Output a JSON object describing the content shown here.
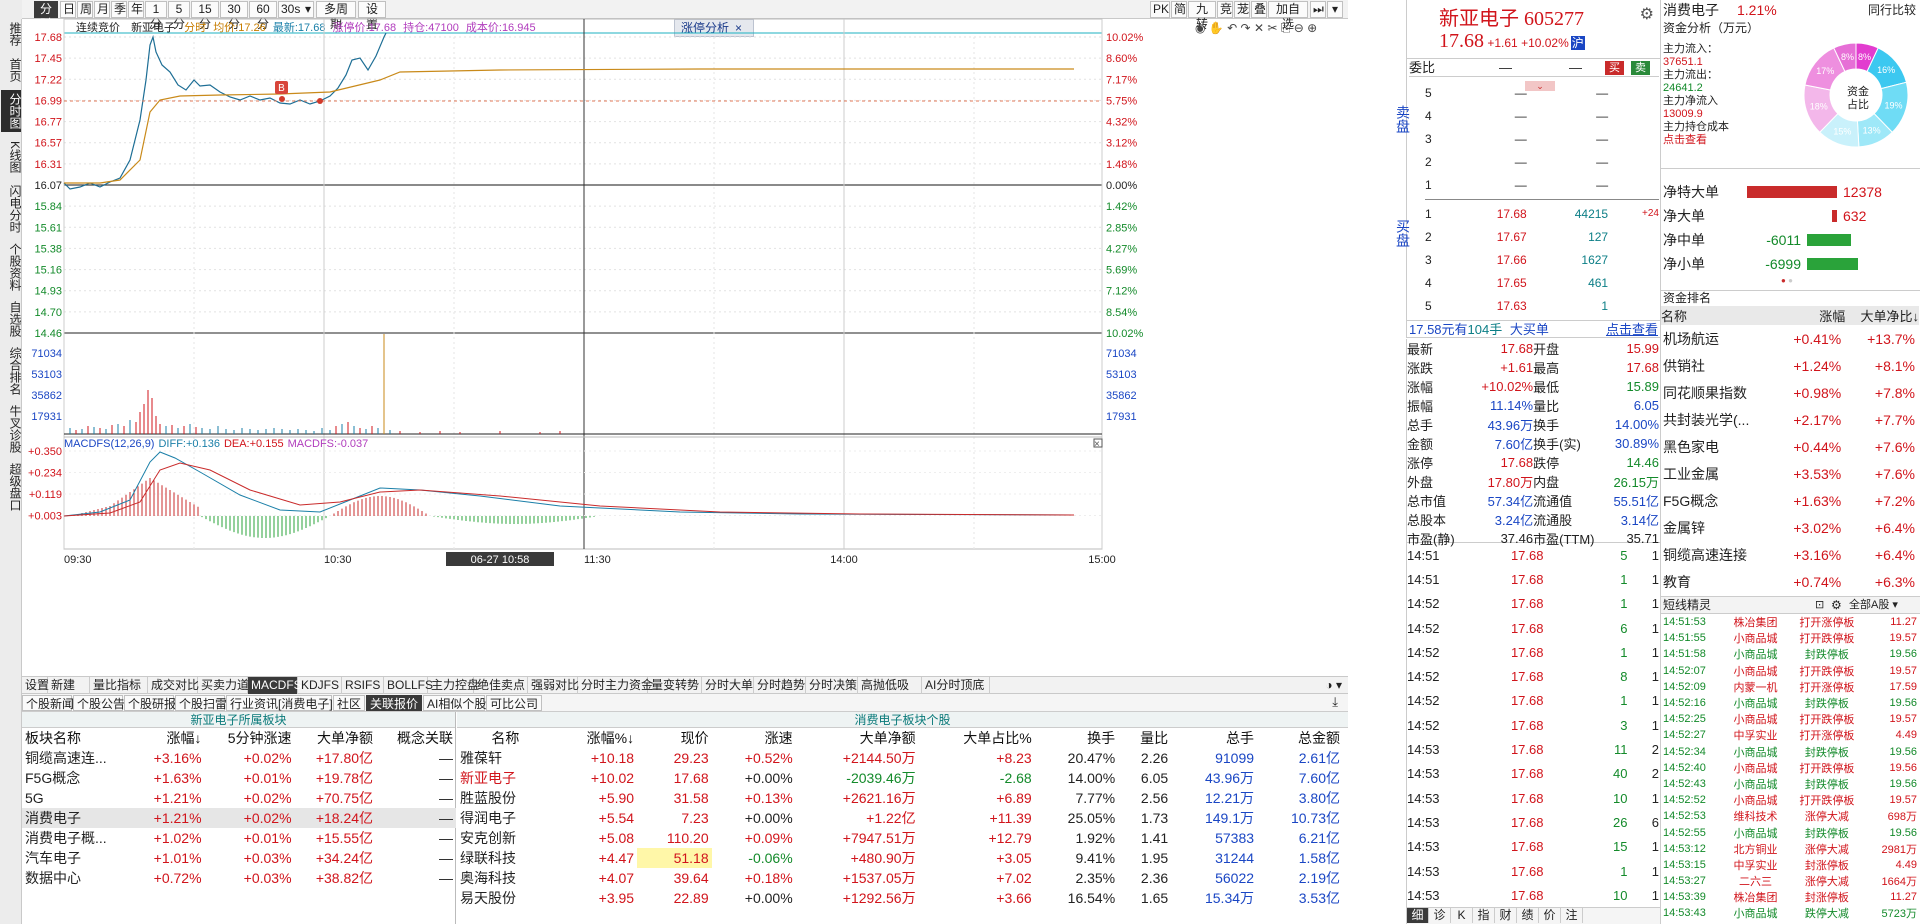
{
  "left_nav": [
    "推荐",
    "首页",
    "分时图",
    "K线图",
    "闪电分时",
    "个股资料",
    "自选股",
    "综合排名",
    "牛叉诊股",
    "超级盘口"
  ],
  "toolbar": {
    "items": [
      "分时",
      "日",
      "周",
      "月",
      "季",
      "年",
      "1分",
      "5分",
      "15分",
      "30分",
      "60分",
      "30s",
      "多周期",
      "设置"
    ],
    "right_items": [
      "PK",
      "简",
      "九转",
      "竞",
      "茏",
      "叠",
      "加自选"
    ],
    "period_select": "30s"
  },
  "chart_info": {
    "label": "连续竞价",
    "name": "新亚电子",
    "ind1": "分时",
    "avg_label": "均价:",
    "avg": "17.26",
    "latest_label": "最新:",
    "latest": "17.68",
    "limit_label": "涨停价:",
    "limit": "17.68",
    "hold_label": "持仓:",
    "hold": "47100",
    "cost_label": "成本价:",
    "cost": "16.945",
    "analysis_btn": "涨停分析"
  },
  "price_axis": {
    "left": [
      "17.68",
      "17.45",
      "17.22",
      "16.99",
      "16.77",
      "16.57",
      "16.31",
      "16.07",
      "15.84",
      "15.61",
      "15.38",
      "15.16",
      "14.93",
      "14.70",
      "14.46"
    ],
    "right": [
      "10.02%",
      "8.60%",
      "7.17%",
      "5.75%",
      "4.32%",
      "3.12%",
      "1.48%",
      "0.00%",
      "1.42%",
      "2.85%",
      "4.27%",
      "5.69%",
      "7.12%",
      "8.54%",
      "10.02%"
    ]
  },
  "vol_axis": {
    "left": [
      "71034",
      "53103",
      "35862",
      "17931"
    ],
    "right": [
      "71034",
      "53103",
      "35862",
      "17931"
    ]
  },
  "macd": {
    "title": "MACDFS(12,26,9)",
    "diff_label": "DIFF:",
    "diff": "+0.136",
    "dea_label": "DEA:",
    "dea": "+0.155",
    "macd_label": "MACDFS:",
    "macd": "-0.037",
    "axis": [
      "+0.350",
      "+0.234",
      "+0.119",
      "+0.003"
    ]
  },
  "time_axis": [
    "09:30",
    "10:30",
    "06-27 10:58",
    "11:30",
    "14:00",
    "15:00"
  ],
  "chart_data": {
    "type": "line",
    "title": "",
    "x": [
      "09:30",
      "10:30",
      "11:30",
      "14:00",
      "15:00"
    ],
    "price_range": [
      14.46,
      17.68
    ],
    "prev_close": 16.07,
    "ylabel": "",
    "note_marker": "B"
  },
  "indicator_tabs": [
    "设置",
    "新建",
    "量比指标",
    "成交对比",
    "买卖力道",
    "MACDFS",
    "KDJFS",
    "RSIFS",
    "BOLLFS",
    "主力控盘",
    "绝佳卖点",
    "强弱对比",
    "分时主力资金",
    "量变转势",
    "分时大单",
    "分时趋势",
    "分时决策",
    "高抛低吸",
    "AI分时顶底"
  ],
  "news_tabs": [
    "个股新闻",
    "个股公告",
    "个股研报",
    "个股扫雷",
    "行业资讯[消费电子]",
    "社区",
    "关联报价",
    "AI相似个股",
    "可比公司"
  ],
  "sector_section": {
    "title": "新亚电子所属板块",
    "headers": [
      "板块名称",
      "涨幅↓",
      "5分钟涨速",
      "大单净额",
      "概念关联"
    ],
    "rows": [
      [
        "铜缆高速连...",
        "+3.16%",
        "+0.02%",
        "+17.80亿",
        "—"
      ],
      [
        "F5G概念",
        "+1.63%",
        "+0.01%",
        "+19.78亿",
        "—"
      ],
      [
        "5G",
        "+1.21%",
        "+0.02%",
        "+70.75亿",
        "—"
      ],
      [
        "消费电子",
        "+1.21%",
        "+0.02%",
        "+18.24亿",
        "—"
      ],
      [
        "消费电子概...",
        "+1.02%",
        "+0.01%",
        "+15.55亿",
        "—"
      ],
      [
        "汽车电子",
        "+1.01%",
        "+0.03%",
        "+34.24亿",
        "—"
      ],
      [
        "数据中心",
        "+0.72%",
        "+0.03%",
        "+38.82亿",
        "—"
      ]
    ]
  },
  "stock_section": {
    "title": "消费电子板块个股",
    "headers": [
      "名称",
      "涨幅%↓",
      "现价",
      "涨速",
      "大单净额",
      "大单占比%",
      "换手",
      "量比",
      "总手",
      "总金额"
    ],
    "rows": [
      [
        "雅葆轩",
        "+10.18",
        "29.23",
        "+0.52%",
        "+2144.50万",
        "+8.23",
        "20.47%",
        "2.26",
        "91099",
        "2.61亿"
      ],
      [
        "新亚电子",
        "+10.02",
        "17.68",
        "+0.00%",
        "-2039.46万",
        "-2.68",
        "14.00%",
        "6.05",
        "43.96万",
        "7.60亿"
      ],
      [
        "胜蓝股份",
        "+5.90",
        "31.58",
        "+0.13%",
        "+2621.16万",
        "+6.89",
        "7.77%",
        "2.56",
        "12.21万",
        "3.80亿"
      ],
      [
        "得润电子",
        "+5.54",
        "7.23",
        "+0.00%",
        "+1.22亿",
        "+11.39",
        "25.05%",
        "1.73",
        "149.1万",
        "10.73亿"
      ],
      [
        "安克创新",
        "+5.08",
        "110.20",
        "+0.09%",
        "+7947.51万",
        "+12.79",
        "1.92%",
        "1.41",
        "57383",
        "6.21亿"
      ],
      [
        "绿联科技",
        "+4.47",
        "51.18",
        "-0.06%",
        "+480.90万",
        "+3.05",
        "9.41%",
        "1.95",
        "31244",
        "1.58亿"
      ],
      [
        "奥海科技",
        "+4.07",
        "39.64",
        "+0.18%",
        "+1537.05万",
        "+7.02",
        "2.35%",
        "2.36",
        "56022",
        "2.19亿"
      ],
      [
        "易天股份",
        "+3.95",
        "22.89",
        "+0.00%",
        "+1292.56万",
        "+3.66",
        "16.54%",
        "1.65",
        "15.34万",
        "3.53亿"
      ]
    ]
  },
  "quote": {
    "name": "新亚电子",
    "code": "605277",
    "price": "17.68",
    "change": "+1.61",
    "pct": "+10.02%",
    "exch": "沪",
    "weibi_label": "委比",
    "weibi": "—",
    "weicha": "—",
    "buy": "买",
    "sell": "卖",
    "asks": [
      [
        "5",
        "—",
        "—"
      ],
      [
        "4",
        "—",
        "—"
      ],
      [
        "3",
        "—",
        "—"
      ],
      [
        "2",
        "—",
        "—"
      ],
      [
        "1",
        "—",
        "—"
      ]
    ],
    "bids": [
      [
        "1",
        "17.68",
        "44215",
        "+24"
      ],
      [
        "2",
        "17.67",
        "127",
        ""
      ],
      [
        "3",
        "17.66",
        "1627",
        ""
      ],
      [
        "4",
        "17.65",
        "461",
        ""
      ],
      [
        "5",
        "17.63",
        "1",
        ""
      ]
    ],
    "ask_side_label": "卖盘",
    "bid_side_label": "买盘",
    "summary": {
      "a": "17.58元有",
      "b": "104手",
      "c": "大买单",
      "d": "点击查看"
    },
    "stats": [
      [
        "最新",
        "17.68",
        "开盘",
        "15.99"
      ],
      [
        "涨跌",
        "+1.61",
        "最高",
        "17.68"
      ],
      [
        "涨幅",
        "+10.02%",
        "最低",
        "15.89"
      ],
      [
        "振幅",
        "11.14%",
        "量比",
        "6.05"
      ],
      [
        "总手",
        "43.96万",
        "换手",
        "14.00%"
      ],
      [
        "金额",
        "7.60亿",
        "换手(实)",
        "30.89%"
      ],
      [
        "涨停",
        "17.68",
        "跌停",
        "14.46"
      ],
      [
        "外盘",
        "17.80万",
        "内盘",
        "26.15万"
      ],
      [
        "总市值",
        "57.34亿",
        "流通值",
        "55.51亿"
      ],
      [
        "总股本",
        "3.24亿",
        "流通股",
        "3.14亿"
      ],
      [
        "市盈(静)",
        "37.46",
        "市盈(TTM)",
        "35.71"
      ]
    ],
    "ticks": [
      [
        "14:51",
        "17.68",
        "5",
        "1"
      ],
      [
        "14:51",
        "17.68",
        "1",
        "1"
      ],
      [
        "14:52",
        "17.68",
        "1",
        "1"
      ],
      [
        "14:52",
        "17.68",
        "6",
        "1"
      ],
      [
        "14:52",
        "17.68",
        "1",
        "1"
      ],
      [
        "14:52",
        "17.68",
        "8",
        "1"
      ],
      [
        "14:52",
        "17.68",
        "1",
        "1"
      ],
      [
        "14:52",
        "17.68",
        "3",
        "1"
      ],
      [
        "14:53",
        "17.68",
        "11",
        "2"
      ],
      [
        "14:53",
        "17.68",
        "40",
        "2"
      ],
      [
        "14:53",
        "17.68",
        "10",
        "1"
      ],
      [
        "14:53",
        "17.68",
        "26",
        "6"
      ],
      [
        "14:53",
        "17.68",
        "15",
        "1"
      ],
      [
        "14:53",
        "17.68",
        "1",
        "1"
      ],
      [
        "14:53",
        "17.68",
        "10",
        "1"
      ]
    ],
    "bottom_tabs": [
      "细",
      "诊",
      "K",
      "指",
      "财",
      "绩",
      "价",
      "注"
    ]
  },
  "funds": {
    "sector": "消费电子",
    "sector_pct": "1.21%",
    "peer_link": "同行比较",
    "title": "资金分析（万元）",
    "inflow_label": "主力流入：",
    "inflow": "37651.1",
    "outflow_label": "主力流出：",
    "outflow": "24641.2",
    "net_label": "主力净流入",
    "net": "13009.9",
    "cost_label": "主力持仓成本",
    "cost_link": "点击查看",
    "donut_center": "资金占比",
    "donut": [
      {
        "pct": "8%",
        "color": "#e23ccf"
      },
      {
        "pct": "16%",
        "color": "#3cc8f0"
      },
      {
        "pct": "19%",
        "color": "#6fdcf5"
      },
      {
        "pct": "13%",
        "color": "#9ee8f8"
      },
      {
        "pct": "15%",
        "color": "#c9f1fb"
      },
      {
        "pct": "18%",
        "color": "#f3b7ea"
      },
      {
        "pct": "17%",
        "color": "#ee8fdf"
      },
      {
        "pct": "8%",
        "color": "#e66fd6"
      }
    ],
    "bars": [
      {
        "label": "净特大单",
        "value": "12378",
        "color": "#c92b2b",
        "frac": 0.9
      },
      {
        "label": "净大单",
        "value": "632",
        "color": "#c92b2b",
        "frac": 0.05
      },
      {
        "label": "净中单",
        "value": "-6011",
        "color": "#2aa33a",
        "frac": 0.44
      },
      {
        "label": "净小单",
        "value": "-6999",
        "color": "#2aa33a",
        "frac": 0.51
      }
    ]
  },
  "rank": {
    "title": "资金排名",
    "headers": [
      "名称",
      "涨幅",
      "大单净比↓"
    ],
    "rows": [
      [
        "机场航运",
        "+0.41%",
        "+13.7%"
      ],
      [
        "供销社",
        "+1.24%",
        "+8.1%"
      ],
      [
        "同花顺果指数",
        "+0.98%",
        "+7.8%"
      ],
      [
        "共封装光学(...",
        "+2.17%",
        "+7.7%"
      ],
      [
        "黑色家电",
        "+0.44%",
        "+7.6%"
      ],
      [
        "工业金属",
        "+3.53%",
        "+7.6%"
      ],
      [
        "F5G概念",
        "+1.63%",
        "+7.2%"
      ],
      [
        "金属锌",
        "+3.02%",
        "+6.4%"
      ],
      [
        "铜缆高速连接",
        "+3.16%",
        "+6.4%"
      ],
      [
        "教育",
        "+0.74%",
        "+6.3%"
      ]
    ]
  },
  "sprite": {
    "title": "短线精灵",
    "filter": "全部A股",
    "rows": [
      [
        "14:51:53",
        "株冶集团",
        "打开涨停板",
        "11.27"
      ],
      [
        "14:51:55",
        "小商品城",
        "打开跌停板",
        "19.57"
      ],
      [
        "14:51:58",
        "小商品城",
        "封跌停板",
        "19.56"
      ],
      [
        "14:52:07",
        "小商品城",
        "打开跌停板",
        "19.57"
      ],
      [
        "14:52:09",
        "内蒙一机",
        "打开涨停板",
        "17.59"
      ],
      [
        "14:52:16",
        "小商品城",
        "封跌停板",
        "19.56"
      ],
      [
        "14:52:25",
        "小商品城",
        "打开跌停板",
        "19.57"
      ],
      [
        "14:52:27",
        "中孚实业",
        "打开涨停板",
        "4.49"
      ],
      [
        "14:52:34",
        "小商品城",
        "封跌停板",
        "19.56"
      ],
      [
        "14:52:40",
        "小商品城",
        "打开跌停板",
        "19.56"
      ],
      [
        "14:52:43",
        "小商品城",
        "封跌停板",
        "19.56"
      ],
      [
        "14:52:52",
        "小商品城",
        "打开跌停板",
        "19.57"
      ],
      [
        "14:52:53",
        "维科技术",
        "涨停大减",
        "698万"
      ],
      [
        "14:52:55",
        "小商品城",
        "封跌停板",
        "19.56"
      ],
      [
        "14:53:12",
        "北方铜业",
        "涨停大减",
        "2981万"
      ],
      [
        "14:53:15",
        "中孚实业",
        "封涨停板",
        "4.49"
      ],
      [
        "14:53:27",
        "二六三",
        "涨停大减",
        "1664万"
      ],
      [
        "14:53:39",
        "株冶集团",
        "封涨停板",
        "11.27"
      ],
      [
        "14:53:43",
        "小商品城",
        "跌停大减",
        "5723万"
      ]
    ]
  }
}
